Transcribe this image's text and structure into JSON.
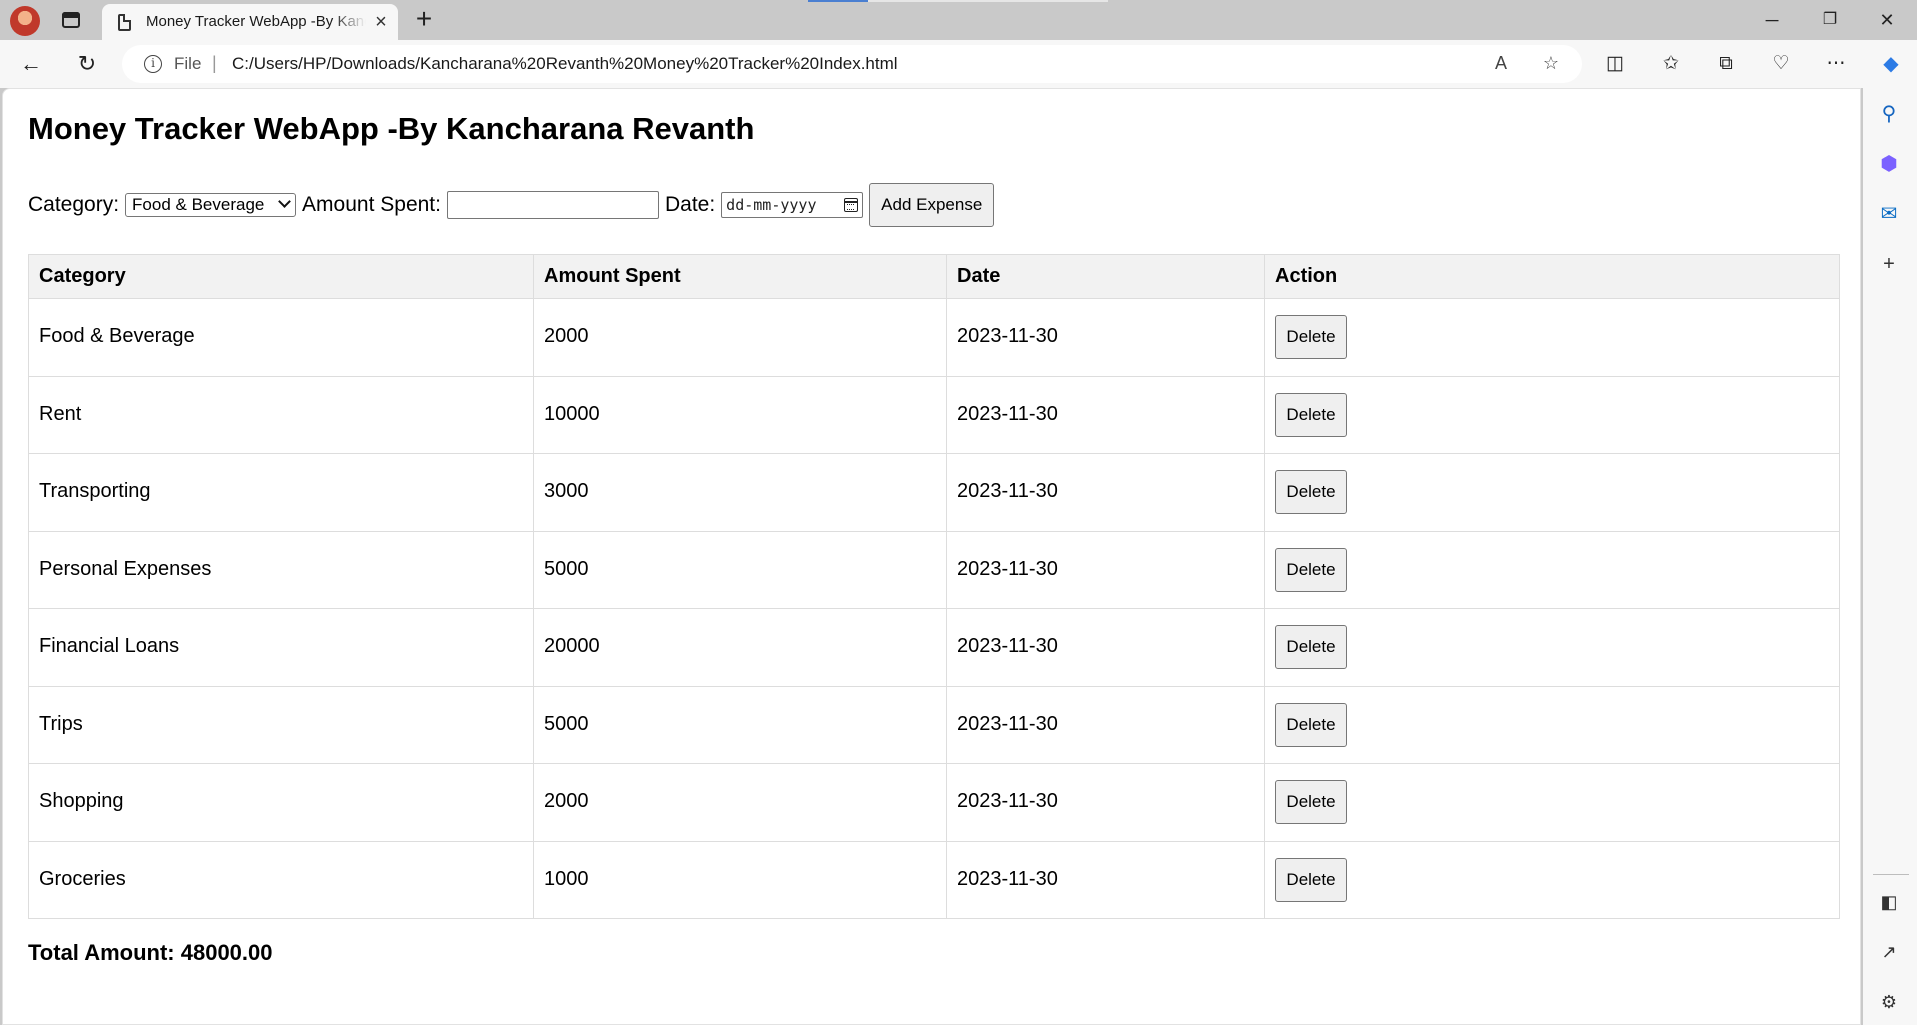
{
  "browser": {
    "tab_title": "Money Tracker WebApp -By Kancharana Revanth",
    "address_scheme_label": "File",
    "address_url": "C:/Users/HP/Downloads/Kancharana%20Revanth%20Money%20Tracker%20Index.html",
    "icons": {
      "profile": "profile-avatar",
      "tabs": "tab-actions-icon",
      "close_tab": "close-icon",
      "new_tab": "plus-icon",
      "back": "back-arrow-icon",
      "reload": "reload-icon",
      "info": "info-icon",
      "read_aloud": "read-aloud-icon",
      "favorite": "star-icon",
      "split": "split-screen-icon",
      "favorites": "favorites-icon",
      "collections": "collections-icon",
      "health": "browser-essentials-icon",
      "more": "more-icon",
      "copilot": "copilot-icon"
    },
    "window_controls": {
      "minimize": "─",
      "restore": "❐",
      "close": "✕"
    },
    "accent": "#0c59a4"
  },
  "page": {
    "title": "Money Tracker WebApp -By Kancharana Revanth",
    "form": {
      "category_label": "Category:",
      "category_selected": "Food & Beverage",
      "amount_label": "Amount Spent:",
      "amount_value": "",
      "date_label": "Date:",
      "date_placeholder": "dd-mm-yyyy",
      "add_button": "Add Expense"
    },
    "table": {
      "headers": [
        "Category",
        "Amount Spent",
        "Date",
        "Action"
      ],
      "delete_label": "Delete",
      "rows": [
        {
          "category": "Food & Beverage",
          "amount": "2000",
          "date": "2023-11-30"
        },
        {
          "category": "Rent",
          "amount": "10000",
          "date": "2023-11-30"
        },
        {
          "category": "Transporting",
          "amount": "3000",
          "date": "2023-11-30"
        },
        {
          "category": "Personal Expenses",
          "amount": "5000",
          "date": "2023-11-30"
        },
        {
          "category": "Financial Loans",
          "amount": "20000",
          "date": "2023-11-30"
        },
        {
          "category": "Trips",
          "amount": "5000",
          "date": "2023-11-30"
        },
        {
          "category": "Shopping",
          "amount": "2000",
          "date": "2023-11-30"
        },
        {
          "category": "Groceries",
          "amount": "1000",
          "date": "2023-11-30"
        }
      ]
    },
    "total_text": "Total Amount: 48000.00"
  }
}
